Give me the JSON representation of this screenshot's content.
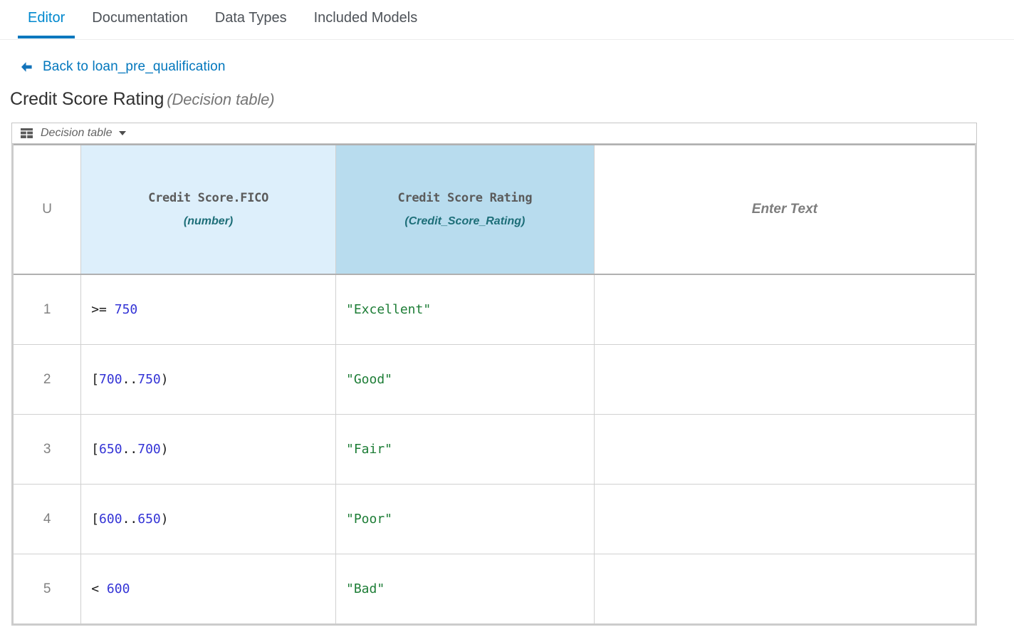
{
  "tabs": [
    {
      "label": "Editor",
      "active": true
    },
    {
      "label": "Documentation",
      "active": false
    },
    {
      "label": "Data Types",
      "active": false
    },
    {
      "label": "Included Models",
      "active": false
    }
  ],
  "back": {
    "icon": "arrow-left-icon",
    "label": "Back to loan_pre_qualification"
  },
  "title": {
    "name": "Credit Score Rating",
    "subtype": "(Decision table)"
  },
  "expression_toolbar": {
    "icon": "table-icon",
    "kind": "Decision table",
    "caret": "chevron-down-icon"
  },
  "decision_table": {
    "hit_policy": "U",
    "columns": [
      {
        "role": "input",
        "name": "Credit Score.FICO",
        "type": "(number)",
        "background": "#ddeffb"
      },
      {
        "role": "output",
        "name": "Credit Score Rating",
        "type": "(Credit_Score_Rating)",
        "background": "#b8dcee"
      },
      {
        "role": "annotation",
        "placeholder": "Enter Text",
        "background": "#ffffff"
      }
    ],
    "rows": [
      {
        "number": "1",
        "input_tokens": [
          {
            "text": ">=",
            "kind": "op"
          },
          {
            "text": " ",
            "kind": "op"
          },
          {
            "text": "750",
            "kind": "num"
          }
        ],
        "output_tokens": [
          {
            "text": "\"Excellent\"",
            "kind": "str"
          }
        ],
        "annotation": ""
      },
      {
        "number": "2",
        "input_tokens": [
          {
            "text": "[",
            "kind": "op"
          },
          {
            "text": "700",
            "kind": "num"
          },
          {
            "text": "..",
            "kind": "op"
          },
          {
            "text": "750",
            "kind": "num"
          },
          {
            "text": ")",
            "kind": "op"
          }
        ],
        "output_tokens": [
          {
            "text": "\"Good\"",
            "kind": "str"
          }
        ],
        "annotation": ""
      },
      {
        "number": "3",
        "input_tokens": [
          {
            "text": "[",
            "kind": "op"
          },
          {
            "text": "650",
            "kind": "num"
          },
          {
            "text": "..",
            "kind": "op"
          },
          {
            "text": "700",
            "kind": "num"
          },
          {
            "text": ")",
            "kind": "op"
          }
        ],
        "output_tokens": [
          {
            "text": "\"Fair\"",
            "kind": "str"
          }
        ],
        "annotation": ""
      },
      {
        "number": "4",
        "input_tokens": [
          {
            "text": "[",
            "kind": "op"
          },
          {
            "text": "600",
            "kind": "num"
          },
          {
            "text": "..",
            "kind": "op"
          },
          {
            "text": "650",
            "kind": "num"
          },
          {
            "text": ")",
            "kind": "op"
          }
        ],
        "output_tokens": [
          {
            "text": "\"Poor\"",
            "kind": "str"
          }
        ],
        "annotation": ""
      },
      {
        "number": "5",
        "input_tokens": [
          {
            "text": "<",
            "kind": "op"
          },
          {
            "text": " ",
            "kind": "op"
          },
          {
            "text": "600",
            "kind": "num"
          }
        ],
        "output_tokens": [
          {
            "text": "\"Bad\"",
            "kind": "str"
          }
        ],
        "annotation": ""
      }
    ]
  },
  "colors": {
    "accent_blue": "#0088ce",
    "link_blue": "#0277bd",
    "input_header": "#ddeffb",
    "output_header": "#b8dcee",
    "number_token": "#3434d6",
    "string_token": "#1d7d36",
    "type_label": "#1d6e78"
  }
}
